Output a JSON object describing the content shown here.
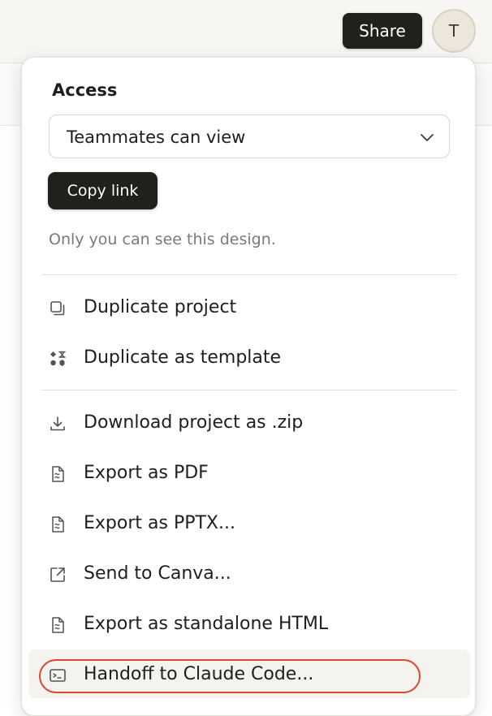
{
  "header": {
    "share_label": "Share",
    "avatar_initial": "T"
  },
  "access": {
    "label": "Access",
    "selected": "Teammates can view",
    "copy_link_label": "Copy link",
    "note": "Only you can see this design."
  },
  "menu": {
    "duplicate_group": [
      {
        "label": "Duplicate project",
        "icon": "duplicate-icon"
      },
      {
        "label": "Duplicate as template",
        "icon": "template-icon"
      }
    ],
    "export_group": [
      {
        "label": "Download project as .zip",
        "icon": "download-icon"
      },
      {
        "label": "Export as PDF",
        "icon": "document-icon"
      },
      {
        "label": "Export as PPTX...",
        "icon": "document-icon"
      },
      {
        "label": "Send to Canva...",
        "icon": "external-link-icon"
      },
      {
        "label": "Export as standalone HTML",
        "icon": "document-icon"
      },
      {
        "label": "Handoff to Claude Code...",
        "icon": "terminal-icon",
        "highlighted": true
      }
    ]
  },
  "colors": {
    "highlight_ring": "#d9482f",
    "dark_button": "#20201d"
  }
}
